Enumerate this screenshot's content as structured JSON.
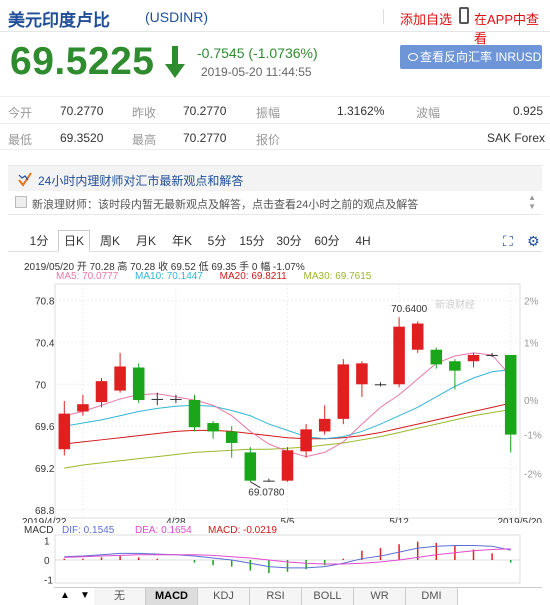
{
  "header": {
    "title": "美元印度卢比",
    "code": "(USDINR)",
    "add_favorite": "添加自选",
    "app_link": "在APP中查看"
  },
  "quote": {
    "price": "69.5225",
    "change": "-0.7545 (-1.0736%)",
    "datetime": "2019-05-20 11:44:55",
    "reverse_button": "查看反向汇率 INRUSD",
    "down_color": "#2e8b2e"
  },
  "stats": {
    "row1": [
      {
        "label": "今开",
        "value": "70.2770"
      },
      {
        "label": "昨收",
        "value": "70.2770"
      },
      {
        "label": "振幅",
        "value": "1.3162%"
      },
      {
        "label": "波幅",
        "value": "0.925"
      }
    ],
    "row2": [
      {
        "label": "最低",
        "value": "69.3520"
      },
      {
        "label": "最高",
        "value": "70.2770"
      },
      {
        "label": "报价",
        "value": "SAK Forex"
      }
    ]
  },
  "promo": {
    "headline": "24小时内理财师对汇市最新观点和解答",
    "ask_text": "新浪理财师：该时段内暂无最新观点及解答，点击查看24小时之前的观点及解答"
  },
  "tabs": [
    "1分",
    "日K",
    "周K",
    "月K",
    "年K",
    "5分",
    "15分",
    "30分",
    "60分",
    "4H"
  ],
  "active_tab": "日K",
  "chart_info": {
    "line1": "2019/05/20  开 70.28  高 70.28  收 69.52  低 69.35  手 0  幅 -1.07%",
    "ma5": "MA5: 70.0777",
    "ma10": "MA10: 70.1447",
    "ma20": "MA20: 69.8211",
    "ma30": "MA30: 69.7615",
    "watermark": "新浪财经"
  },
  "chart_data": {
    "type": "candlestick",
    "ylim": [
      68.8,
      70.9
    ],
    "y_ticks": [
      "70.8",
      "70.4",
      "70",
      "69.6",
      "69.2",
      "68.8"
    ],
    "pct_ticks": [
      "2%",
      "1%",
      "0%",
      "-1%",
      "-2%"
    ],
    "x_labels": [
      "2019/4/22",
      "4/28",
      "5/5",
      "5/12",
      "2019/5/20"
    ],
    "high_annotation": "70.6400",
    "low_annotation": "69.0780",
    "candles": [
      {
        "o": 69.38,
        "c": 69.72,
        "h": 69.84,
        "l": 69.32
      },
      {
        "o": 69.74,
        "c": 69.81,
        "h": 69.9,
        "l": 69.7
      },
      {
        "o": 69.83,
        "c": 70.03,
        "h": 70.06,
        "l": 69.78
      },
      {
        "o": 69.94,
        "c": 70.17,
        "h": 70.3,
        "l": 69.92
      },
      {
        "o": 70.16,
        "c": 69.85,
        "h": 70.2,
        "l": 69.82
      },
      {
        "o": 69.86,
        "c": 69.86,
        "h": 69.92,
        "l": 69.8
      },
      {
        "o": 69.86,
        "c": 69.86,
        "h": 69.9,
        "l": 69.82
      },
      {
        "o": 69.85,
        "c": 69.59,
        "h": 69.9,
        "l": 69.55
      },
      {
        "o": 69.63,
        "c": 69.55,
        "h": 69.65,
        "l": 69.48
      },
      {
        "o": 69.55,
        "c": 69.44,
        "h": 69.6,
        "l": 69.3
      },
      {
        "o": 69.35,
        "c": 69.08,
        "h": 69.4,
        "l": 69.07
      },
      {
        "o": 69.08,
        "c": 69.08,
        "h": 69.1,
        "l": 69.07
      },
      {
        "o": 69.08,
        "c": 69.37,
        "h": 69.4,
        "l": 69.07
      },
      {
        "o": 69.36,
        "c": 69.57,
        "h": 69.62,
        "l": 69.3
      },
      {
        "o": 69.55,
        "c": 69.67,
        "h": 69.8,
        "l": 69.52
      },
      {
        "o": 69.67,
        "c": 70.19,
        "h": 70.24,
        "l": 69.62
      },
      {
        "o": 70.0,
        "c": 70.2,
        "h": 70.22,
        "l": 69.88
      },
      {
        "o": 70.0,
        "c": 70.0,
        "h": 70.02,
        "l": 69.98
      },
      {
        "o": 70.0,
        "c": 70.55,
        "h": 70.64,
        "l": 69.97
      },
      {
        "o": 70.33,
        "c": 70.58,
        "h": 70.6,
        "l": 70.3
      },
      {
        "o": 70.33,
        "c": 70.19,
        "h": 70.35,
        "l": 70.15
      },
      {
        "o": 70.22,
        "c": 70.13,
        "h": 70.24,
        "l": 69.95
      },
      {
        "o": 70.22,
        "c": 70.28,
        "h": 70.3,
        "l": 70.16
      },
      {
        "o": 70.28,
        "c": 70.28,
        "h": 70.3,
        "l": 70.26
      },
      {
        "o": 70.28,
        "c": 69.52,
        "h": 70.28,
        "l": 69.35
      }
    ],
    "ma5": [
      69.7,
      69.74,
      69.8,
      69.86,
      69.9,
      69.91,
      69.88,
      69.85,
      69.8,
      69.7,
      69.55,
      69.43,
      69.36,
      69.31,
      69.35,
      69.45,
      69.62,
      69.78,
      69.9,
      70.05,
      70.2,
      70.27,
      70.3,
      70.28,
      70.08
    ],
    "ma10": [
      69.6,
      69.63,
      69.66,
      69.7,
      69.74,
      69.77,
      69.79,
      69.8,
      69.79,
      69.75,
      69.7,
      69.62,
      69.56,
      69.5,
      69.48,
      69.5,
      69.55,
      69.62,
      69.7,
      69.78,
      69.88,
      69.98,
      70.06,
      70.12,
      70.14
    ],
    "ma20": [
      69.43,
      69.45,
      69.47,
      69.49,
      69.51,
      69.53,
      69.55,
      69.56,
      69.56,
      69.55,
      69.53,
      69.51,
      69.49,
      69.48,
      69.48,
      69.49,
      69.51,
      69.54,
      69.58,
      69.62,
      69.66,
      69.7,
      69.74,
      69.78,
      69.82
    ],
    "ma30": [
      69.2,
      69.23,
      69.25,
      69.27,
      69.29,
      69.31,
      69.33,
      69.35,
      69.36,
      69.37,
      69.38,
      69.38,
      69.39,
      69.4,
      69.42,
      69.44,
      69.47,
      69.5,
      69.54,
      69.58,
      69.62,
      69.66,
      69.7,
      69.73,
      69.76
    ],
    "ma_colors": {
      "ma5": "#e878a8",
      "ma10": "#33b5d6",
      "ma20": "#d11a1a",
      "ma30": "#9ab82c"
    }
  },
  "macd": {
    "label": "MACD",
    "dif": "DIF: 0.1545",
    "dea": "DEA: 0.1654",
    "macd": "MACD: -0.0219",
    "y_ticks": [
      "1",
      "0",
      "-1"
    ],
    "dif_values": [
      0.05,
      0.06,
      0.08,
      0.1,
      0.1,
      0.09,
      0.08,
      0.06,
      0.03,
      0.0,
      -0.05,
      -0.1,
      -0.12,
      -0.12,
      -0.1,
      -0.05,
      0.02,
      0.06,
      0.12,
      0.18,
      0.21,
      0.22,
      0.22,
      0.21,
      0.15
    ],
    "dea_values": [
      0.04,
      0.05,
      0.06,
      0.07,
      0.08,
      0.08,
      0.08,
      0.08,
      0.07,
      0.05,
      0.03,
      0.0,
      -0.03,
      -0.05,
      -0.06,
      -0.06,
      -0.05,
      -0.03,
      0.0,
      0.04,
      0.08,
      0.11,
      0.14,
      0.16,
      0.17
    ],
    "hist_values": [
      0.02,
      0.02,
      0.04,
      0.06,
      0.04,
      0.02,
      0.0,
      -0.04,
      -0.08,
      -0.1,
      -0.16,
      -0.2,
      -0.18,
      -0.14,
      -0.08,
      0.02,
      0.14,
      0.18,
      0.24,
      0.28,
      0.26,
      0.22,
      0.16,
      0.1,
      -0.04
    ]
  },
  "indicators": [
    "无",
    "MACD",
    "KDJ",
    "RSI",
    "BOLL",
    "WR",
    "DMI"
  ],
  "active_indicator": "MACD"
}
